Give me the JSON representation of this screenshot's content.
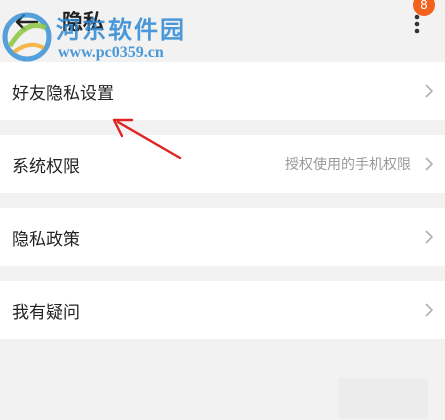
{
  "header": {
    "title": "隐私",
    "back_icon": "back-arrow-icon",
    "more_icon": "more-vertical-icon",
    "badge_count": "8"
  },
  "watermark": {
    "name": "河东软件园",
    "url": "www.pc0359.cn"
  },
  "settings": {
    "items": [
      {
        "label": "好友隐私设置",
        "value": ""
      },
      {
        "label": "系统权限",
        "value": "授权使用的手机权限"
      },
      {
        "label": "隐私政策",
        "value": ""
      },
      {
        "label": "我有疑问",
        "value": ""
      }
    ]
  },
  "colors": {
    "accent_badge": "#f2611d",
    "watermark": "#2d89d3",
    "annotation_arrow": "#e02424",
    "background": "#f2f2f2"
  }
}
